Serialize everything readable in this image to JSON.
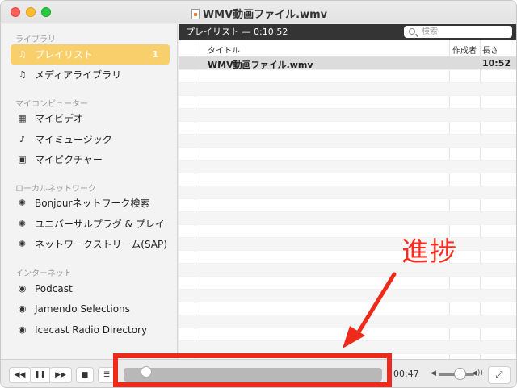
{
  "window": {
    "title": "WMV動画ファイル.wmv"
  },
  "sidebar": {
    "section_library": "ライブラリ",
    "playlist_label": "プレイリスト",
    "playlist_count": "1",
    "media_library_label": "メディアライブラリ",
    "section_my_computer": "マイコンピューター",
    "my_videos": "マイビデオ",
    "my_music": "マイミュージック",
    "my_pictures": "マイピクチャー",
    "section_local_network": "ローカルネットワーク",
    "bonjour": "Bonjourネットワーク検索",
    "upnp": "ユニバーサルプラグ & プレイ",
    "sap": "ネットワークストリーム(SAP)",
    "section_internet": "インターネット",
    "podcast": "Podcast",
    "jamendo": "Jamendo Selections",
    "icecast": "Icecast Radio Directory"
  },
  "playlist": {
    "header_title": "プレイリスト — 0:10:52",
    "search_placeholder": "検索",
    "col_title": "タイトル",
    "col_author": "作成者",
    "col_length": "長さ",
    "rows": [
      {
        "title": "WMV動画ファイル.wmv",
        "length": "10:52"
      }
    ]
  },
  "controls": {
    "rewind_icon": "◀◀",
    "pause_icon": "❚❚",
    "forward_icon": "▶▶",
    "stop_icon": "■",
    "playlist_icon": "☰",
    "elapsed_time": "00:47",
    "seek_progress": 0.07,
    "volume_level": 0.6,
    "fullscreen_icon": "⤢"
  },
  "annotation": {
    "label": "進捗",
    "color": "#ee2a1a"
  }
}
